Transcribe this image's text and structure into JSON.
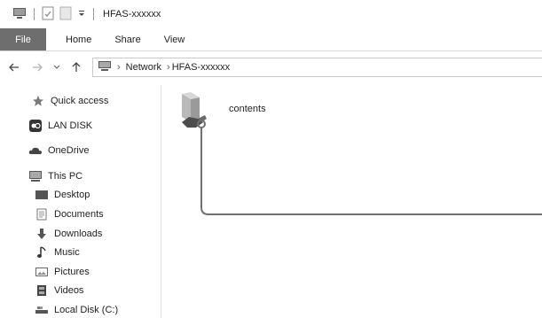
{
  "window": {
    "title": "HFAS-xxxxxx"
  },
  "ribbon": {
    "tabs": [
      "File",
      "Home",
      "Share",
      "View"
    ]
  },
  "address": {
    "crumbs": [
      "Network",
      "HFAS-xxxxxx"
    ]
  },
  "sidebar": {
    "quick_access": "Quick access",
    "lan_disk": "LAN DISK",
    "onedrive": "OneDrive",
    "this_pc": "This PC",
    "items": [
      "Desktop",
      "Documents",
      "Downloads",
      "Music",
      "Pictures",
      "Videos",
      "Local Disk (C:)"
    ]
  },
  "content": {
    "folder_name": "contents"
  },
  "colors": {
    "file_tab": "#6e6e6e",
    "callout_line": "#707070"
  }
}
